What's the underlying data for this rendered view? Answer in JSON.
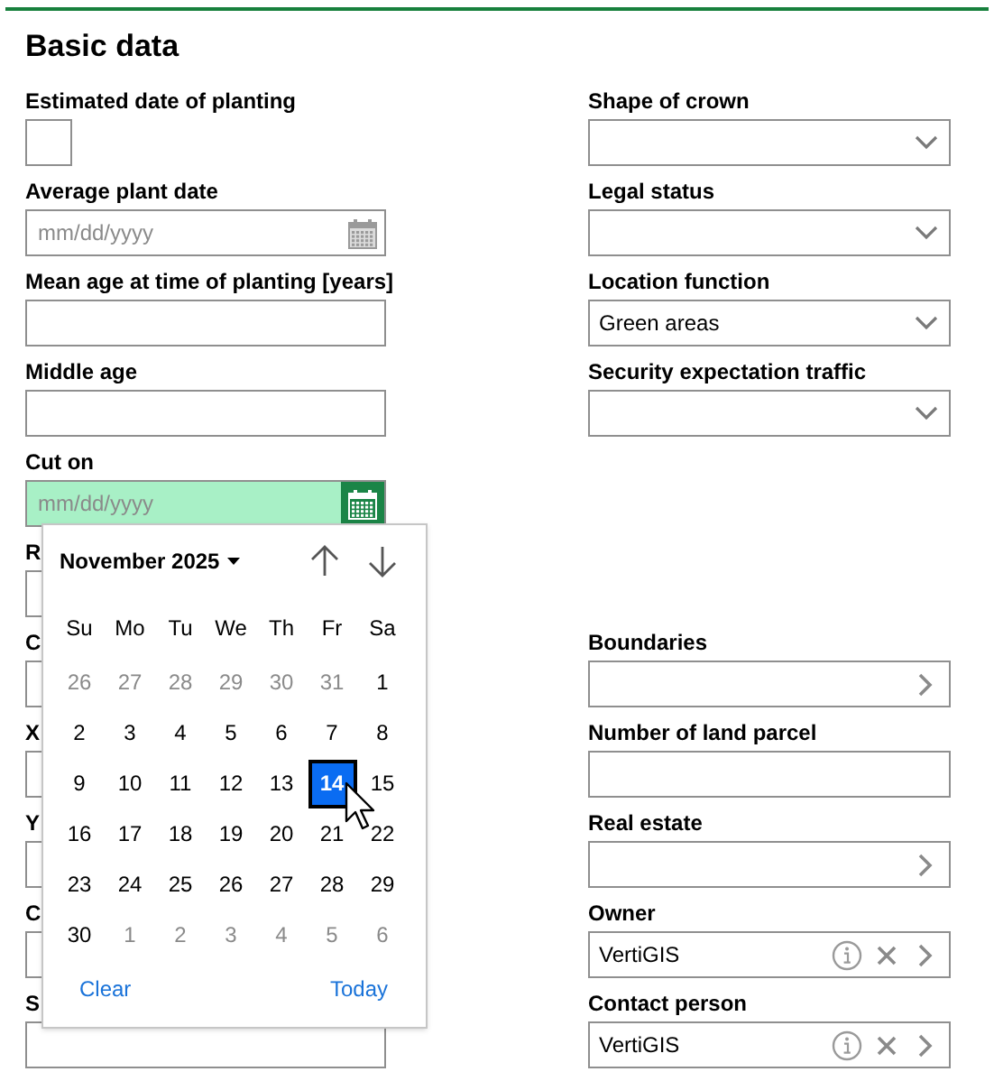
{
  "title": "Basic data",
  "left_fields": [
    {
      "label": "Estimated date of planting",
      "kind": "checkbox",
      "checked": false
    },
    {
      "label": "Average plant date",
      "kind": "date",
      "placeholder": "mm/dd/yyyy",
      "focused": false
    },
    {
      "label": "Mean age at time of planting [years]",
      "kind": "text"
    },
    {
      "label": "Middle age",
      "kind": "text"
    },
    {
      "label": "Cut on",
      "kind": "date",
      "placeholder": "mm/dd/yyyy",
      "focused": true
    },
    {
      "label": "R",
      "kind": "text"
    },
    {
      "label": "C",
      "kind": "text"
    },
    {
      "label": "X",
      "kind": "text"
    },
    {
      "label": "Y",
      "kind": "text"
    },
    {
      "label": "C",
      "kind": "text"
    },
    {
      "label": "S",
      "kind": "text"
    }
  ],
  "right_fields_upper": [
    {
      "label": "Shape of crown",
      "kind": "select"
    },
    {
      "label": "Legal status",
      "kind": "select"
    },
    {
      "label": "Location function",
      "kind": "select",
      "value": "Green areas"
    },
    {
      "label": "Security expectation traffic",
      "kind": "select"
    }
  ],
  "right_fields_lower": [
    {
      "label": "Boundaries",
      "kind": "lookup"
    },
    {
      "label": "Number of land parcel",
      "kind": "text"
    },
    {
      "label": "Real estate",
      "kind": "lookup"
    },
    {
      "label": "Owner",
      "kind": "lookup",
      "value": "VertiGIS"
    },
    {
      "label": "Contact person",
      "kind": "lookup",
      "value": "VertiGIS"
    }
  ],
  "calendar": {
    "month": "November 2025",
    "weekdays": [
      "Su",
      "Mo",
      "Tu",
      "We",
      "Th",
      "Fr",
      "Sa"
    ],
    "weeks": [
      [
        {
          "day": "26",
          "outside": true,
          "selected": false
        },
        {
          "day": "27",
          "outside": true,
          "selected": false
        },
        {
          "day": "28",
          "outside": true,
          "selected": false
        },
        {
          "day": "29",
          "outside": true,
          "selected": false
        },
        {
          "day": "30",
          "outside": true,
          "selected": false
        },
        {
          "day": "31",
          "outside": true,
          "selected": false
        },
        {
          "day": "1",
          "outside": false,
          "selected": false
        }
      ],
      [
        {
          "day": "2",
          "outside": false,
          "selected": false
        },
        {
          "day": "3",
          "outside": false,
          "selected": false
        },
        {
          "day": "4",
          "outside": false,
          "selected": false
        },
        {
          "day": "5",
          "outside": false,
          "selected": false
        },
        {
          "day": "6",
          "outside": false,
          "selected": false
        },
        {
          "day": "7",
          "outside": false,
          "selected": false
        },
        {
          "day": "8",
          "outside": false,
          "selected": false
        }
      ],
      [
        {
          "day": "9",
          "outside": false,
          "selected": false
        },
        {
          "day": "10",
          "outside": false,
          "selected": false
        },
        {
          "day": "11",
          "outside": false,
          "selected": false
        },
        {
          "day": "12",
          "outside": false,
          "selected": false
        },
        {
          "day": "13",
          "outside": false,
          "selected": false
        },
        {
          "day": "14",
          "outside": false,
          "selected": true
        },
        {
          "day": "15",
          "outside": false,
          "selected": false
        }
      ],
      [
        {
          "day": "16",
          "outside": false,
          "selected": false
        },
        {
          "day": "17",
          "outside": false,
          "selected": false
        },
        {
          "day": "18",
          "outside": false,
          "selected": false
        },
        {
          "day": "19",
          "outside": false,
          "selected": false
        },
        {
          "day": "20",
          "outside": false,
          "selected": false
        },
        {
          "day": "21",
          "outside": false,
          "selected": false
        },
        {
          "day": "22",
          "outside": false,
          "selected": false
        }
      ],
      [
        {
          "day": "23",
          "outside": false,
          "selected": false
        },
        {
          "day": "24",
          "outside": false,
          "selected": false
        },
        {
          "day": "25",
          "outside": false,
          "selected": false
        },
        {
          "day": "26",
          "outside": false,
          "selected": false
        },
        {
          "day": "27",
          "outside": false,
          "selected": false
        },
        {
          "day": "28",
          "outside": false,
          "selected": false
        },
        {
          "day": "29",
          "outside": false,
          "selected": false
        }
      ],
      [
        {
          "day": "30",
          "outside": false,
          "selected": false
        },
        {
          "day": "1",
          "outside": true,
          "selected": false
        },
        {
          "day": "2",
          "outside": true,
          "selected": false
        },
        {
          "day": "3",
          "outside": true,
          "selected": false
        },
        {
          "day": "4",
          "outside": true,
          "selected": false
        },
        {
          "day": "5",
          "outside": true,
          "selected": false
        },
        {
          "day": "6",
          "outside": true,
          "selected": false
        }
      ]
    ],
    "actions": [
      "Clear",
      "Today"
    ]
  }
}
